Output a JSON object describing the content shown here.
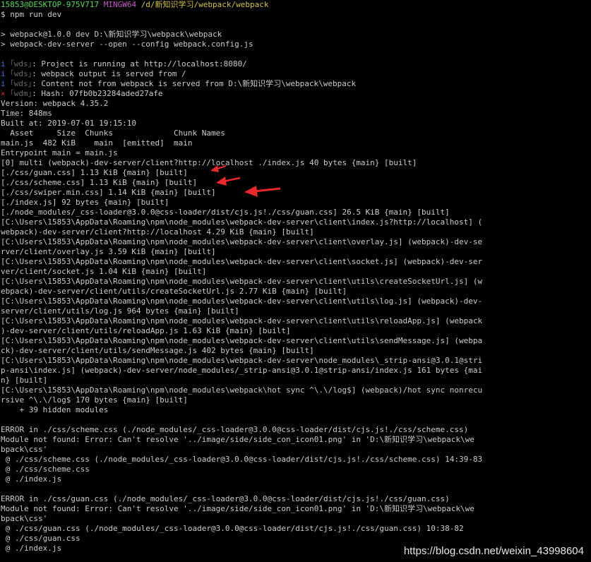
{
  "terminal": {
    "lines": [
      {
        "segs": [
          {
            "t": "15853@DESKTOP-975V717 ",
            "c": "green"
          },
          {
            "t": "MINGW64 ",
            "c": "magenta"
          },
          {
            "t": "/d/新知识学习/webpack/webpack",
            "c": "yellow"
          }
        ]
      },
      {
        "segs": [
          {
            "t": "$ npm run dev",
            "c": "default"
          }
        ]
      },
      {
        "segs": [
          {
            "t": "",
            "c": "default"
          }
        ]
      },
      {
        "segs": [
          {
            "t": "> webpack@1.0.0 dev D:\\新知识学习\\webpack\\webpack",
            "c": "default"
          }
        ]
      },
      {
        "segs": [
          {
            "t": "> webpack-dev-server --open --config webpack.config.js",
            "c": "default"
          }
        ]
      },
      {
        "segs": [
          {
            "t": "",
            "c": "default"
          }
        ]
      },
      {
        "segs": [
          {
            "t": "i ",
            "c": "blue"
          },
          {
            "t": "｢wds｣",
            "c": "gray"
          },
          {
            "t": ": Project is running at http://localhost:8080/",
            "c": "default"
          }
        ]
      },
      {
        "segs": [
          {
            "t": "i ",
            "c": "blue"
          },
          {
            "t": "｢wds｣",
            "c": "gray"
          },
          {
            "t": ": webpack output is served from /",
            "c": "default"
          }
        ]
      },
      {
        "segs": [
          {
            "t": "i ",
            "c": "blue"
          },
          {
            "t": "｢wds｣",
            "c": "gray"
          },
          {
            "t": ": Content not from webpack is served from D:\\新知识学习\\webpack\\webpack",
            "c": "default"
          }
        ]
      },
      {
        "segs": [
          {
            "t": "× ",
            "c": "red"
          },
          {
            "t": "｢wdm｣",
            "c": "gray"
          },
          {
            "t": ": Hash: 07fb0b23284aded27afe",
            "c": "default"
          }
        ]
      },
      {
        "segs": [
          {
            "t": "Version: webpack 4.35.2",
            "c": "default"
          }
        ]
      },
      {
        "segs": [
          {
            "t": "Time: 848ms",
            "c": "default"
          }
        ]
      },
      {
        "segs": [
          {
            "t": "Built at: 2019-07-01 19:15:10",
            "c": "default"
          }
        ]
      },
      {
        "segs": [
          {
            "t": "  Asset     Size  Chunks             Chunk Names",
            "c": "default"
          }
        ]
      },
      {
        "segs": [
          {
            "t": "main.js  482 KiB    main  [emitted]  main",
            "c": "default"
          }
        ]
      },
      {
        "segs": [
          {
            "t": "Entrypoint main = main.js",
            "c": "default"
          }
        ]
      },
      {
        "segs": [
          {
            "t": "[0] multi (webpack)-dev-server/client?http://localhost ./index.js 40 bytes {main} [built]",
            "c": "default"
          }
        ]
      },
      {
        "segs": [
          {
            "t": "[./css/guan.css] 1.13 KiB {main} [built]",
            "c": "default"
          }
        ]
      },
      {
        "segs": [
          {
            "t": "[./css/scheme.css] 1.13 KiB {main} [built]",
            "c": "default"
          }
        ]
      },
      {
        "segs": [
          {
            "t": "[./css/swiper.min.css] 1.14 KiB {main} [built]",
            "c": "default"
          }
        ]
      },
      {
        "segs": [
          {
            "t": "[./index.js] 92 bytes {main} [built]",
            "c": "default"
          }
        ]
      },
      {
        "segs": [
          {
            "t": "[./node_modules/_css-loader@3.0.0@css-loader/dist/cjs.js!./css/guan.css] 26.5 KiB {main} [built]",
            "c": "default"
          }
        ]
      },
      {
        "segs": [
          {
            "t": "[C:\\Users\\15853\\AppData\\Roaming\\npm\\node_modules\\webpack-dev-server\\client\\index.js?http://localhost] (",
            "c": "default"
          }
        ]
      },
      {
        "segs": [
          {
            "t": "webpack)-dev-server/client?http://localhost 4.29 KiB {main} [built]",
            "c": "default"
          }
        ]
      },
      {
        "segs": [
          {
            "t": "[C:\\Users\\15853\\AppData\\Roaming\\npm\\node_modules\\webpack-dev-server\\client\\overlay.js] (webpack)-dev-se",
            "c": "default"
          }
        ]
      },
      {
        "segs": [
          {
            "t": "rver/client/overlay.js 3.59 KiB {main} [built]",
            "c": "default"
          }
        ]
      },
      {
        "segs": [
          {
            "t": "[C:\\Users\\15853\\AppData\\Roaming\\npm\\node_modules\\webpack-dev-server\\client\\socket.js] (webpack)-dev-ser",
            "c": "default"
          }
        ]
      },
      {
        "segs": [
          {
            "t": "ver/client/socket.js 1.04 KiB {main} [built]",
            "c": "default"
          }
        ]
      },
      {
        "segs": [
          {
            "t": "[C:\\Users\\15853\\AppData\\Roaming\\npm\\node_modules\\webpack-dev-server\\client\\utils\\createSocketUrl.js] (w",
            "c": "default"
          }
        ]
      },
      {
        "segs": [
          {
            "t": "ebpack)-dev-server/client/utils/createSocketUrl.js 2.77 KiB {main} [built]",
            "c": "default"
          }
        ]
      },
      {
        "segs": [
          {
            "t": "[C:\\Users\\15853\\AppData\\Roaming\\npm\\node_modules\\webpack-dev-server\\client\\utils\\log.js] (webpack)-dev-",
            "c": "default"
          }
        ]
      },
      {
        "segs": [
          {
            "t": "server/client/utils/log.js 964 bytes {main} [built]",
            "c": "default"
          }
        ]
      },
      {
        "segs": [
          {
            "t": "[C:\\Users\\15853\\AppData\\Roaming\\npm\\node_modules\\webpack-dev-server\\client\\utils\\reloadApp.js] (webpack",
            "c": "default"
          }
        ]
      },
      {
        "segs": [
          {
            "t": ")-dev-server/client/utils/reloadApp.js 1.63 KiB {main} [built]",
            "c": "default"
          }
        ]
      },
      {
        "segs": [
          {
            "t": "[C:\\Users\\15853\\AppData\\Roaming\\npm\\node_modules\\webpack-dev-server\\client\\utils\\sendMessage.js] (webpa",
            "c": "default"
          }
        ]
      },
      {
        "segs": [
          {
            "t": "ck)-dev-server/client/utils/sendMessage.js 402 bytes {main} [built]",
            "c": "default"
          }
        ]
      },
      {
        "segs": [
          {
            "t": "[C:\\Users\\15853\\AppData\\Roaming\\npm\\node_modules\\webpack-dev-server\\node_modules\\_strip-ansi@3.0.1@stri",
            "c": "default"
          }
        ]
      },
      {
        "segs": [
          {
            "t": "p-ansi\\index.js] (webpack)-dev-server/node_modules/_strip-ansi@3.0.1@strip-ansi/index.js 161 bytes {mai",
            "c": "default"
          }
        ]
      },
      {
        "segs": [
          {
            "t": "n} [built]",
            "c": "default"
          }
        ]
      },
      {
        "segs": [
          {
            "t": "[C:\\Users\\15853\\AppData\\Roaming\\npm\\node_modules\\webpack\\hot sync ^\\.\\/log$] (webpack)/hot sync nonrecu",
            "c": "default"
          }
        ]
      },
      {
        "segs": [
          {
            "t": "rsive ^\\.\\/log$ 170 bytes {main} [built]",
            "c": "default"
          }
        ]
      },
      {
        "segs": [
          {
            "t": "    + 39 hidden modules",
            "c": "default"
          }
        ]
      },
      {
        "segs": [
          {
            "t": "",
            "c": "default"
          }
        ]
      },
      {
        "segs": [
          {
            "t": "ERROR in ./css/scheme.css (./node_modules/_css-loader@3.0.0@css-loader/dist/cjs.js!./css/scheme.css)",
            "c": "default"
          }
        ]
      },
      {
        "segs": [
          {
            "t": "Module not found: Error: Can't resolve '../image/side/side_con_icon01.png' in 'D:\\新知识学习\\webpack\\we",
            "c": "default"
          }
        ]
      },
      {
        "segs": [
          {
            "t": "bpack\\css'",
            "c": "default"
          }
        ]
      },
      {
        "segs": [
          {
            "t": " @ ./css/scheme.css (./node_modules/_css-loader@3.0.0@css-loader/dist/cjs.js!./css/scheme.css) 14:39-83",
            "c": "default"
          }
        ]
      },
      {
        "segs": [
          {
            "t": " @ ./css/scheme.css",
            "c": "default"
          }
        ]
      },
      {
        "segs": [
          {
            "t": " @ ./index.js",
            "c": "default"
          }
        ]
      },
      {
        "segs": [
          {
            "t": "",
            "c": "default"
          }
        ]
      },
      {
        "segs": [
          {
            "t": "ERROR in ./css/guan.css (./node_modules/_css-loader@3.0.0@css-loader/dist/cjs.js!./css/guan.css)",
            "c": "default"
          }
        ]
      },
      {
        "segs": [
          {
            "t": "Module not found: Error: Can't resolve '../image/side/side_con_icon01.png' in 'D:\\新知识学习\\webpack\\we",
            "c": "default"
          }
        ]
      },
      {
        "segs": [
          {
            "t": "bpack\\css'",
            "c": "default"
          }
        ]
      },
      {
        "segs": [
          {
            "t": " @ ./css/guan.css (./node_modules/_css-loader@3.0.0@css-loader/dist/cjs.js!./css/guan.css) 10:38-82",
            "c": "default"
          }
        ]
      },
      {
        "segs": [
          {
            "t": " @ ./css/guan.css",
            "c": "default"
          }
        ]
      },
      {
        "segs": [
          {
            "t": " @ ./index.js",
            "c": "default"
          }
        ]
      }
    ]
  },
  "annotations": {
    "arrow_color": "#e8282a",
    "arrows": [
      "arrow-guan",
      "arrow-scheme",
      "arrow-swiper"
    ]
  },
  "watermark": {
    "text": "https://blog.csdn.net/weixin_43998604"
  }
}
